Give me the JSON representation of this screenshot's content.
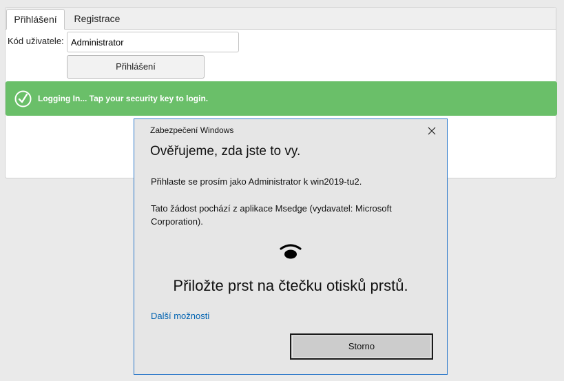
{
  "tabs": [
    {
      "label": "Přihlášení",
      "active": true
    },
    {
      "label": "Registrace",
      "active": false
    }
  ],
  "form": {
    "user_label": "Kód uživatele:",
    "user_value": "Administrator",
    "login_button": "Přihlášení"
  },
  "banner": {
    "icon": "check-circle-icon",
    "text": "Logging In... Tap your security key to login.",
    "color": "#6abf69"
  },
  "dialog": {
    "title": "Zabezpečení Windows",
    "heading": "Ověřujeme, zda jste to vy.",
    "message1": "Přihlaste se prosím jako Administrator k win2019-tu2.",
    "message2": "Tato žádost pochází z aplikace Msedge (vydavatel: Microsoft Corporation).",
    "icon": "fingerprint-icon",
    "prompt": "Přiložte prst na čtečku otisků prstů.",
    "more_options": "Další možnosti",
    "cancel_button": "Storno",
    "accent_color": "#2b78c9"
  }
}
